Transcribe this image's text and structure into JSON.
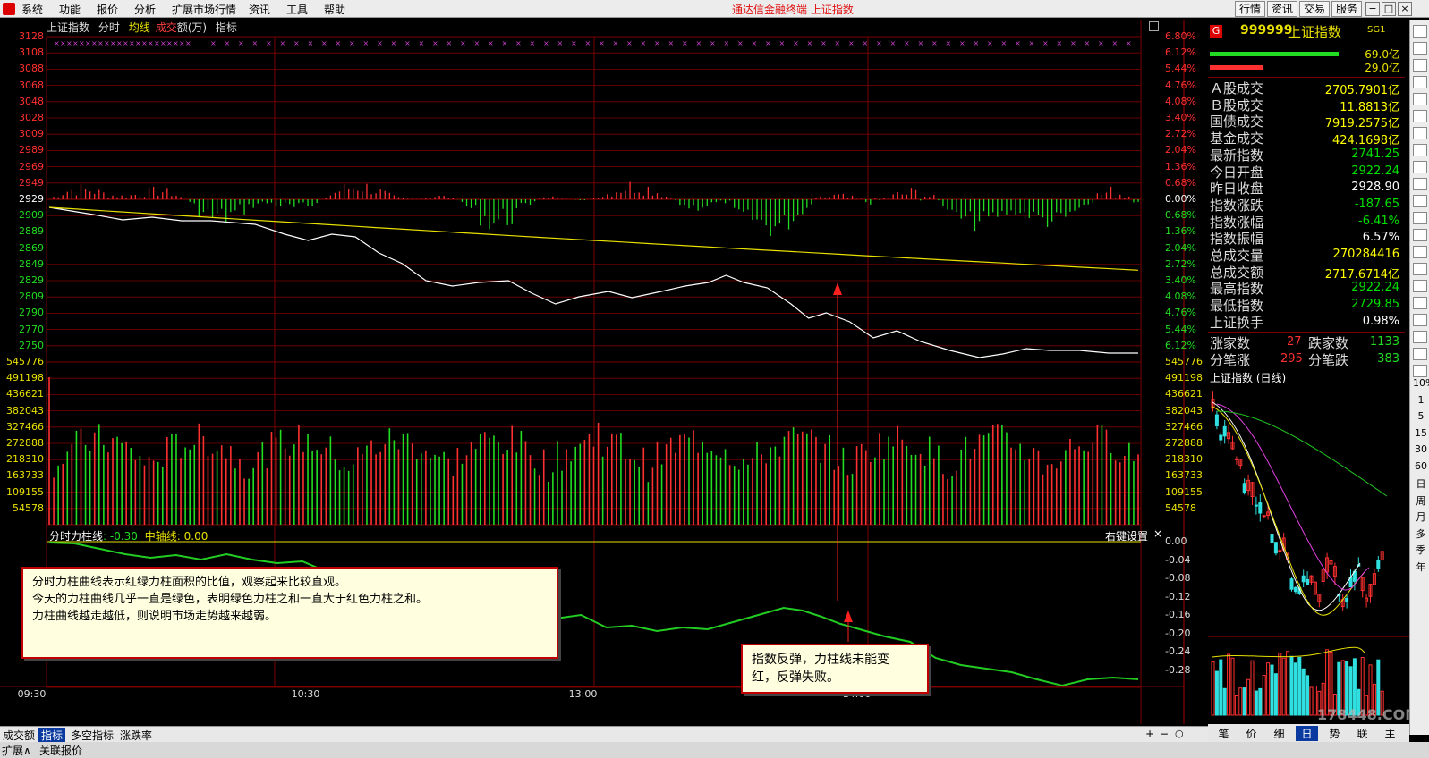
{
  "menu": {
    "items": [
      "系统",
      "功能",
      "报价",
      "分析",
      "扩展市场行情",
      "资讯",
      "工具",
      "帮助"
    ],
    "title": "通达信金融终端  上证指数",
    "buttons": [
      "行情",
      "资讯",
      "交易",
      "服务"
    ],
    "window_controls": [
      "−",
      "□",
      "×"
    ]
  },
  "chart_header": {
    "name": "上证指数",
    "mode": "分时",
    "avg": "均线",
    "vol_a": "成交",
    "vol_b": "额(万)",
    "indicator": "指标"
  },
  "price_axis": {
    "left": [
      "3128",
      "3108",
      "3088",
      "3068",
      "3048",
      "3028",
      "3009",
      "2989",
      "2969",
      "2949",
      "2929",
      "2909",
      "2889",
      "2869",
      "2849",
      "2829",
      "2809",
      "2790",
      "2770",
      "2750"
    ],
    "right": [
      "6.80%",
      "6.12%",
      "5.44%",
      "4.76%",
      "4.08%",
      "3.40%",
      "2.72%",
      "2.04%",
      "1.36%",
      "0.68%",
      "0.00%",
      "0.68%",
      "1.36%",
      "2.04%",
      "2.72%",
      "3.40%",
      "4.08%",
      "4.76%",
      "5.44%",
      "6.12%"
    ]
  },
  "volume_axis": [
    "545776",
    "491198",
    "436621",
    "382043",
    "327466",
    "272888",
    "218310",
    "163733",
    "109155",
    "54578"
  ],
  "indicator_panel": {
    "name": "分时力柱线",
    "value": ": -0.30",
    "mid_name": "中轴线",
    "mid_value": ": 0.00",
    "settings": "右键设置",
    "close": "×",
    "axis": [
      "0.00",
      "-0.04",
      "-0.08",
      "-0.12",
      "-0.16",
      "-0.20",
      "-0.24",
      "-0.28"
    ]
  },
  "time_axis": [
    "09:30",
    "10:30",
    "13:00",
    "14:00"
  ],
  "info": {
    "logo": "G",
    "code": "999999",
    "name": "上证指数",
    "tag": "SG1",
    "bar1": "69.0亿",
    "bar2": "29.0亿",
    "rows": [
      {
        "label": "Ａ股成交",
        "value": "2705.7901亿",
        "color": "#ffff00"
      },
      {
        "label": "Ｂ股成交",
        "value": "11.8813亿",
        "color": "#ffff00"
      },
      {
        "label": "国债成交",
        "value": "7919.2575亿",
        "color": "#ffff00"
      },
      {
        "label": "基金成交",
        "value": "424.1698亿",
        "color": "#ffff00"
      },
      {
        "label": "最新指数",
        "value": "2741.25",
        "color": "#00e000"
      },
      {
        "label": "今日开盘",
        "value": "2922.24",
        "color": "#00e000"
      },
      {
        "label": "昨日收盘",
        "value": "2928.90",
        "color": "#ffffff"
      },
      {
        "label": "指数涨跌",
        "value": "-187.65",
        "color": "#00e000"
      },
      {
        "label": "指数涨幅",
        "value": "-6.41%",
        "color": "#00e000"
      },
      {
        "label": "指数振幅",
        "value": "6.57%",
        "color": "#ffffff"
      },
      {
        "label": "总成交量",
        "value": "270284416",
        "color": "#ffff00"
      },
      {
        "label": "总成交额",
        "value": "2717.6714亿",
        "color": "#ffff00"
      },
      {
        "label": "最高指数",
        "value": "2922.24",
        "color": "#00e000"
      },
      {
        "label": "最低指数",
        "value": "2729.85",
        "color": "#00e000"
      },
      {
        "label": "上证换手",
        "value": "0.98%",
        "color": "#ffffff"
      }
    ],
    "rise_label": "涨家数",
    "rise": "27",
    "fall_label": "跌家数",
    "fall": "1133",
    "up_tick_label": "分笔涨",
    "up_tick": "295",
    "down_tick_label": "分笔跌",
    "down_tick": "383"
  },
  "kline": {
    "title": "上证指数 (日线)",
    "tabs": [
      "笔",
      "价",
      "细",
      "日",
      "势",
      "联",
      "主"
    ]
  },
  "annotations": {
    "note1": [
      "分时力柱曲线表示红绿力柱面积的比值，观察起来比较直观。",
      "今天的力柱曲线几乎一直是绿色，表明绿色力柱之和一直大于红色力柱之和。",
      "力柱曲线越走越低，则说明市场走势越来越弱。"
    ],
    "note2": [
      "指数反弹，力柱线未能变",
      "红，反弹失败。"
    ]
  },
  "bottom_tabs": [
    "成交额",
    "指标",
    "多空指标",
    "涨跌率"
  ],
  "status": [
    "扩展∧",
    "关联报价"
  ],
  "side_toolbar": {
    "labels": [
      "10%",
      "1",
      "5",
      "15",
      "30",
      "60",
      "日",
      "周",
      "月",
      "多",
      "季",
      "年"
    ]
  },
  "watermark": "178448.COM",
  "colors": {
    "grid": "#7a0000",
    "price": "#ffffff",
    "avg": "#e8e000",
    "force": "#22cc22",
    "up": "#ff3030",
    "down": "#22dd22"
  }
}
